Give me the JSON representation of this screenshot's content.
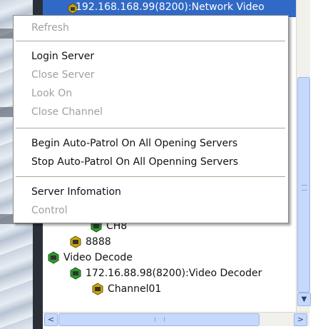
{
  "header_row": {
    "text": "192.168.168.99(8200):Network Video"
  },
  "menu": {
    "items": [
      {
        "label": "Refresh",
        "enabled": false
      },
      {
        "label": "Login Server",
        "enabled": true
      },
      {
        "label": "Close Server",
        "enabled": false
      },
      {
        "label": "Look On",
        "enabled": false
      },
      {
        "label": "Close Channel",
        "enabled": false
      },
      {
        "label": "Begin Auto-Patrol On All Opening Servers",
        "enabled": true
      },
      {
        "label": "Stop Auto-Patrol On All Openning  Servers",
        "enabled": true
      },
      {
        "label": "Server Infomation",
        "enabled": true
      },
      {
        "label": "Control",
        "enabled": false
      }
    ]
  },
  "tree": {
    "nodes": [
      {
        "label": "CH8",
        "icon": "camera-device-icon"
      },
      {
        "label": "8888",
        "icon": "camera-device-icon"
      },
      {
        "label": "Video Decode",
        "icon": "decoder-group-icon"
      },
      {
        "label": "172.16.88.98(8200):Video Decoder",
        "icon": "decoder-device-icon"
      },
      {
        "label": "Channel01",
        "icon": "camera-device-icon"
      }
    ]
  },
  "scrollbars": {
    "vertical_down_arrow": "▼",
    "horizontal_left_arrow": "<",
    "horizontal_right_arrow": ">"
  }
}
